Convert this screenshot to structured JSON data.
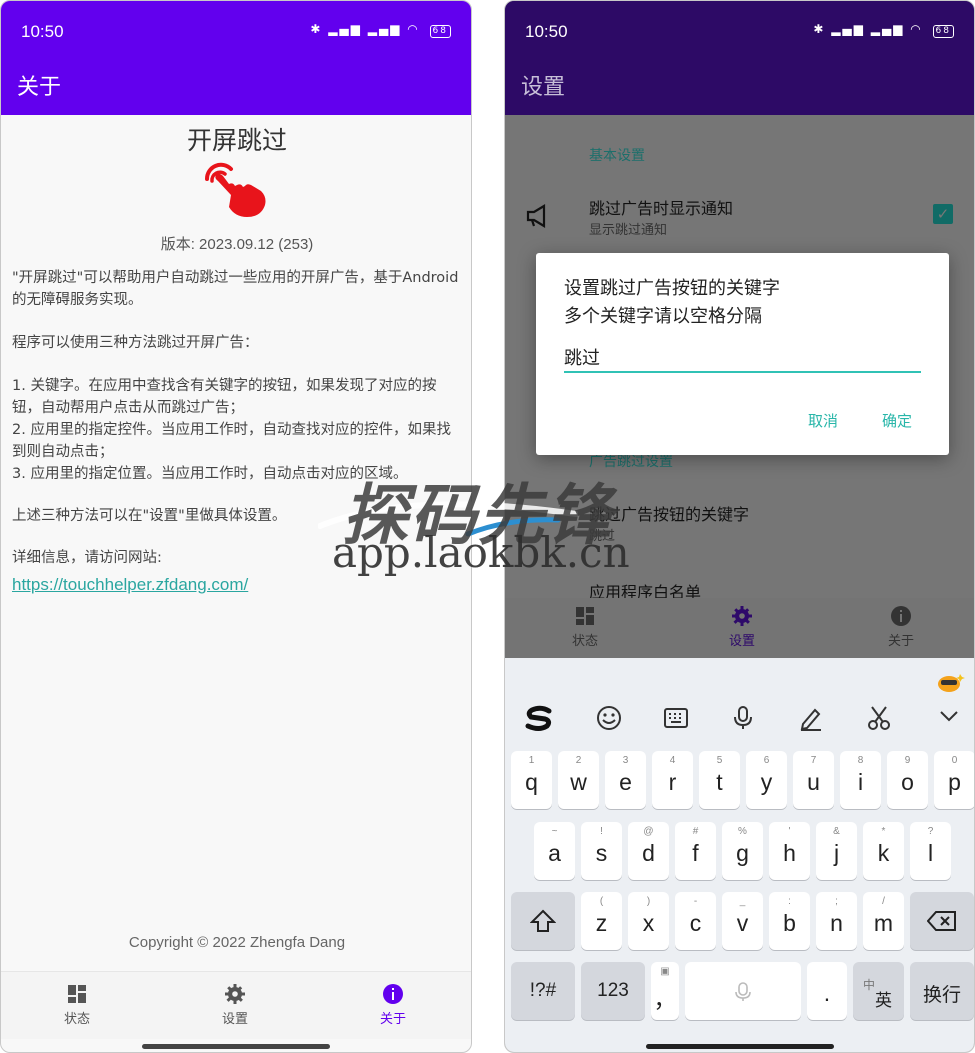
{
  "left": {
    "status_time": "10:50",
    "battery": "68",
    "appbar_title": "关于",
    "about_title": "开屏跳过",
    "version": "版本: 2023.09.12 (253)",
    "intro_1": "\"开屏跳过\"可以帮助用户自动跳过一些应用的开屏广告，基于Android的无障碍服务实现。",
    "intro_2": "程序可以使用三种方法跳过开屏广告：",
    "method_1": "1. 关键字。在应用中查找含有关键字的按钮，如果发现了对应的按钮，自动帮用户点击从而跳过广告；",
    "method_2": "2. 应用里的指定控件。当应用工作时，自动查找对应的控件，如果找到则自动点击；",
    "method_3": "3. 应用里的指定位置。当应用工作时，自动点击对应的区域。",
    "intro_3": "上述三种方法可以在\"设置\"里做具体设置。",
    "detail_label": "详细信息，请访问网站:",
    "website": "https://touchhelper.zfdang.com/",
    "copyright": "Copyright © 2022 Zhengfa Dang",
    "nav": [
      {
        "label": "状态",
        "icon": "dashboard-icon"
      },
      {
        "label": "设置",
        "icon": "gear-icon"
      },
      {
        "label": "关于",
        "icon": "info-icon",
        "active": true
      }
    ]
  },
  "right": {
    "status_time": "10:50",
    "battery": "68",
    "appbar_title": "设置",
    "section_basic": "基本设置",
    "item_notify_title": "跳过广告时显示通知",
    "item_notify_sub": "显示跳过通知",
    "section_ad": "广告跳过设置",
    "item_keyword_title": "跳过广告按钮的关键字",
    "item_keyword_sub": "跳过",
    "item_whitelist_title": "应用程序白名单",
    "dialog": {
      "title_line1": "设置跳过广告按钮的关键字",
      "title_line2": "多个关键字请以空格分隔",
      "input_value": "跳过",
      "cancel": "取消",
      "ok": "确定"
    },
    "nav": [
      {
        "label": "状态",
        "icon": "dashboard-icon"
      },
      {
        "label": "设置",
        "icon": "gear-icon",
        "active": true
      },
      {
        "label": "关于",
        "icon": "info-icon"
      }
    ],
    "keyboard": {
      "row1": [
        {
          "hint": "1",
          "key": "q"
        },
        {
          "hint": "2",
          "key": "w"
        },
        {
          "hint": "3",
          "key": "e"
        },
        {
          "hint": "4",
          "key": "r"
        },
        {
          "hint": "5",
          "key": "t"
        },
        {
          "hint": "6",
          "key": "y"
        },
        {
          "hint": "7",
          "key": "u"
        },
        {
          "hint": "8",
          "key": "i"
        },
        {
          "hint": "9",
          "key": "o"
        },
        {
          "hint": "0",
          "key": "p"
        }
      ],
      "row2": [
        {
          "hint": "~",
          "key": "a"
        },
        {
          "hint": "!",
          "key": "s"
        },
        {
          "hint": "@",
          "key": "d"
        },
        {
          "hint": "#",
          "key": "f"
        },
        {
          "hint": "%",
          "key": "g"
        },
        {
          "hint": "'",
          "key": "h"
        },
        {
          "hint": "&",
          "key": "j"
        },
        {
          "hint": "*",
          "key": "k"
        },
        {
          "hint": "?",
          "key": "l"
        }
      ],
      "row3": [
        {
          "hint": "(",
          "key": "z"
        },
        {
          "hint": ")",
          "key": "x"
        },
        {
          "hint": "-",
          "key": "c"
        },
        {
          "hint": "_",
          "key": "v"
        },
        {
          "hint": ":",
          "key": "b"
        },
        {
          "hint": ";",
          "key": "n"
        },
        {
          "hint": "/",
          "key": "m"
        }
      ],
      "symbols": "!?#",
      "numbers": "123",
      "comma": "，",
      "period": ".",
      "lang_top": "中",
      "lang_main": "英",
      "enter": "换行"
    }
  },
  "watermark": {
    "main": "探码先锋",
    "sub": "app.laokbk.cn"
  },
  "colors": {
    "primary": "#6200ee",
    "accent": "#2aa6a0",
    "hand": "#e8141b"
  }
}
